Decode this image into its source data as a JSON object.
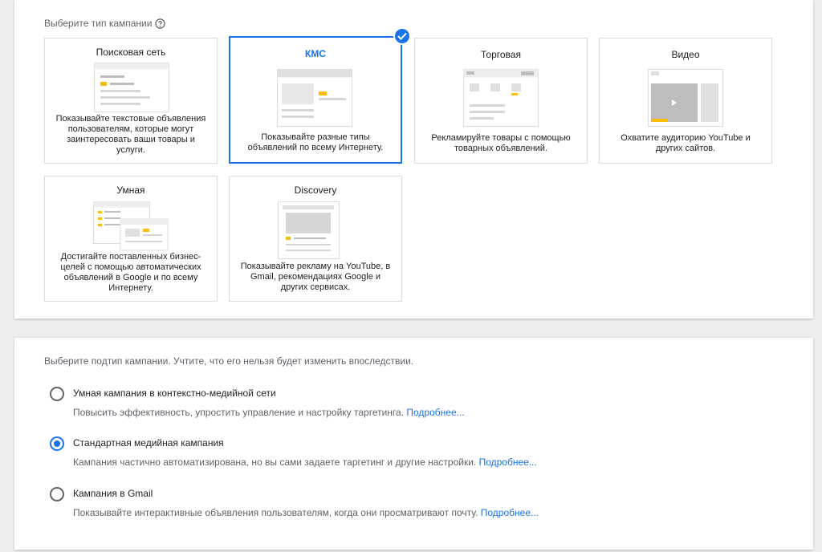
{
  "type_section": {
    "title": "Выберите тип кампании",
    "cards": [
      {
        "name": "Поисковая сеть",
        "desc": "Показывайте текстовые объявления пользователям, которые могут заинтересовать ваши товары и услуги.",
        "selected": false
      },
      {
        "name": "КМС",
        "desc": "Показывайте разные типы объявлений по всему Интернету.",
        "selected": true
      },
      {
        "name": "Торговая",
        "desc": "Рекламируйте товары с помощью товарных объявлений.",
        "selected": false
      },
      {
        "name": "Видео",
        "desc": "Охватите аудиторию YouTube и других сайтов.",
        "selected": false
      },
      {
        "name": "Умная",
        "desc": "Достигайте поставленных бизнес-целей с помощью автоматических объявлений в Google и по всему Интернету.",
        "selected": false
      },
      {
        "name": "Discovery",
        "desc": "Показывайте рекламу на YouTube, в Gmail, рекомендациях Google и других сервисах.",
        "selected": false
      }
    ]
  },
  "subtype_section": {
    "title": "Выберите подтип кампании. Учтите, что его нельзя будет изменить впоследствии.",
    "options": [
      {
        "label": "Умная кампания в контекстно-медийной сети",
        "desc": "Повысить эффективность, упростить управление и настройку таргетинга.",
        "link": "Подробнее...",
        "checked": false
      },
      {
        "label": "Стандартная медийная кампания",
        "desc": "Кампания частично автоматизирована, но вы сами задаете таргетинг и другие настройки.",
        "link": "Подробнее...",
        "checked": true
      },
      {
        "label": "Кампания в Gmail",
        "desc": "Показывайте интерактивные объявления пользователям, когда они просматривают почту.",
        "link": "Подробнее...",
        "checked": false
      }
    ]
  },
  "colors": {
    "accent": "#1a73e8",
    "ad_highlight": "#fbbc04"
  }
}
